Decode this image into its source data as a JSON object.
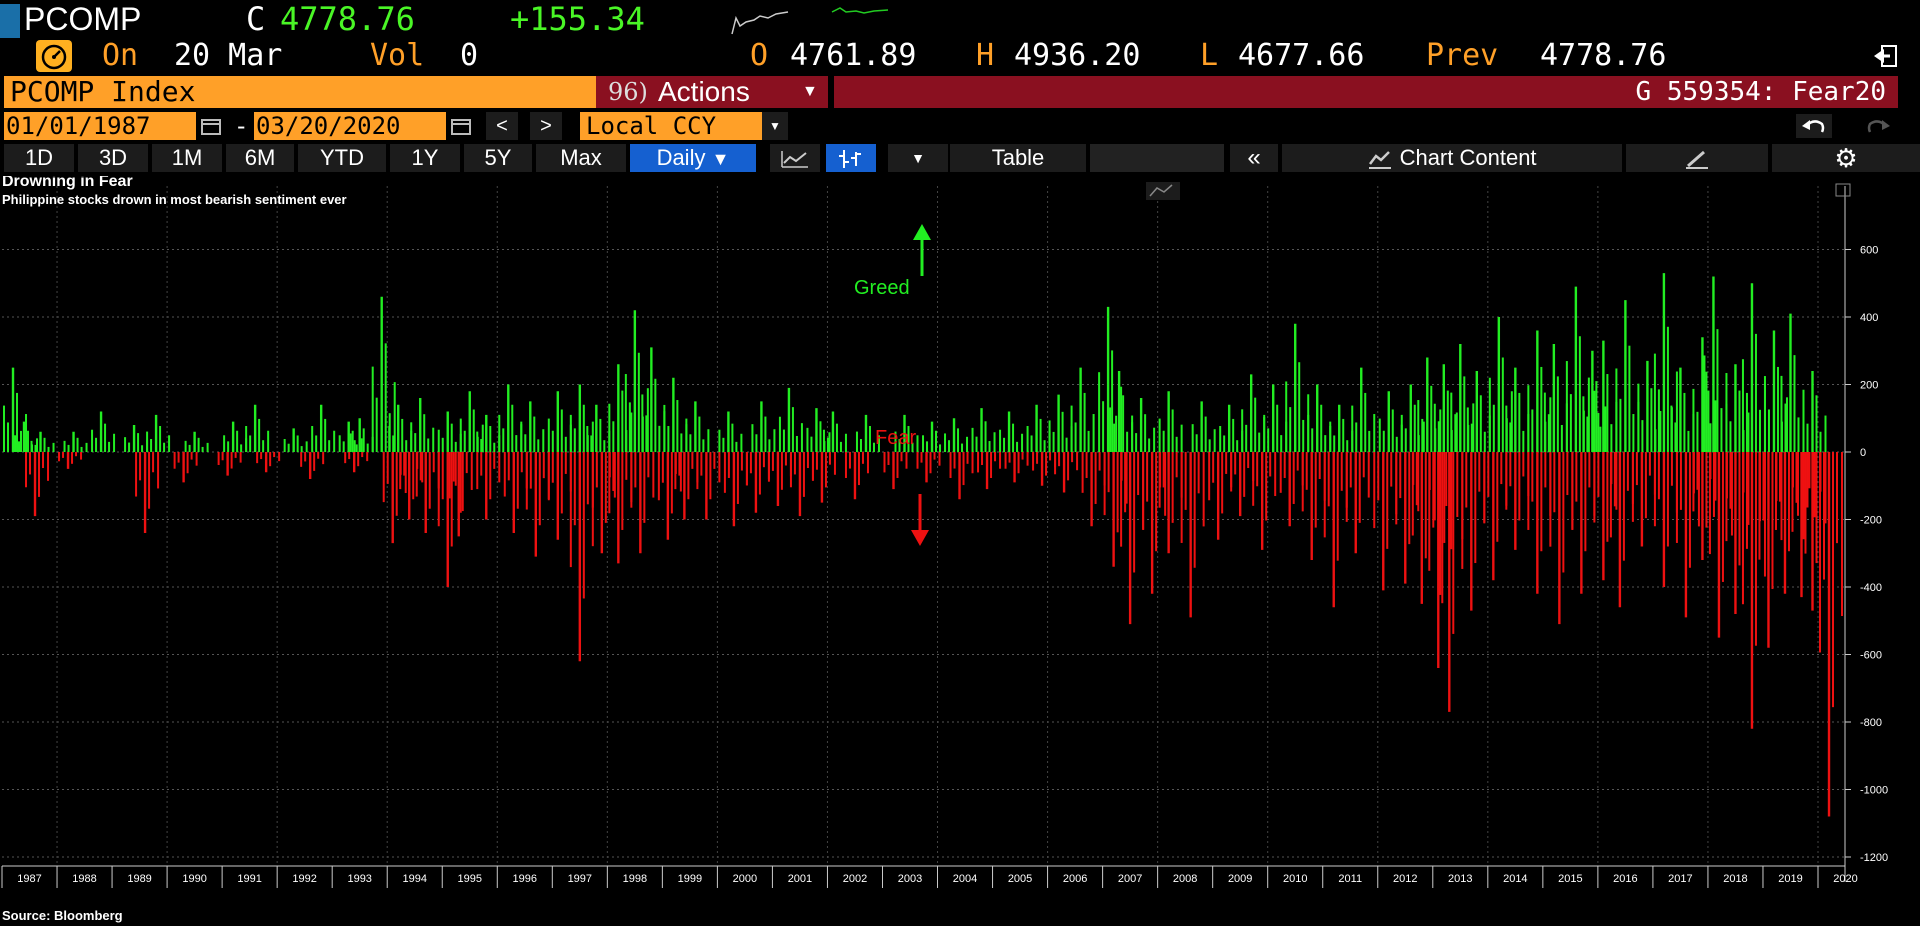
{
  "header": {
    "ticker": "PCOMP",
    "close_label": "C",
    "close_value": "4778.76",
    "change": "+155.34",
    "on_label": "On",
    "date": "20 Mar",
    "vol_label": "Vol",
    "vol_value": "0",
    "open_label": "O",
    "open_value": "4761.89",
    "high_label": "H",
    "high_value": "4936.20",
    "low_label": "L",
    "low_value": "4677.66",
    "prev_label": "Prev",
    "prev_value": "4778.76"
  },
  "toolbar": {
    "security": "PCOMP Index",
    "actions_num": "96)",
    "actions_label": "Actions",
    "function_label": "G 559354: Fear20",
    "start_date": "01/01/1987",
    "dash": "-",
    "end_date": "03/20/2020",
    "prev_glyph": "<",
    "next_glyph": ">",
    "currency": "Local CCY",
    "ranges": [
      "1D",
      "3D",
      "1M",
      "6M",
      "YTD",
      "1Y",
      "5Y",
      "Max"
    ],
    "frequency": "Daily",
    "table_label": "Table",
    "chart_content_label": "Chart Content"
  },
  "colors": {
    "positive": "#22ee22",
    "negative": "#ee1111",
    "orange": "#ffa028",
    "band_red": "#8a1020",
    "active_blue": "#1560d0"
  },
  "chart_data": {
    "type": "bar",
    "title": "Drowning in Fear",
    "subtitle": "Philippine stocks drown in most bearish sentiment ever",
    "source": "Source: Bloomberg",
    "annotations": {
      "greed": "Greed",
      "fear": "Fear"
    },
    "x_years": [
      "1987",
      "1988",
      "1989",
      "1990",
      "1991",
      "1992",
      "1993",
      "1994",
      "1995",
      "1996",
      "1997",
      "1998",
      "1999",
      "2000",
      "2001",
      "2002",
      "2003",
      "2004",
      "2005",
      "2006",
      "2007",
      "2008",
      "2009",
      "2010",
      "2011",
      "2012",
      "2013",
      "2014",
      "2015",
      "2016",
      "2017",
      "2018",
      "2019",
      "2020"
    ],
    "y_ticks": [
      "600",
      "400",
      "200",
      "0",
      "-200",
      "-400",
      "-600",
      "-800",
      "-1000",
      "-1200"
    ],
    "ylim": [
      -1200,
      650
    ],
    "legend": "none",
    "grid": true,
    "series": [
      {
        "color": "positive",
        "x": [
          1987.2,
          1987.4,
          1987.7,
          1988.3,
          1988.8,
          1989.4,
          1989.8,
          1990.5,
          1991.2,
          1991.6,
          1992.3,
          1992.8,
          1993.3,
          1993.5,
          1993.9,
          1994.2,
          1994.6,
          1995.1,
          1995.5,
          1995.8,
          1996.2,
          1996.6,
          1997.1,
          1997.5,
          1997.8,
          1998.2,
          1998.5,
          1998.8,
          1999.2,
          1999.6,
          2000.2,
          2000.8,
          2001.3,
          2001.8,
          2002.1,
          2002.7,
          2003.4,
          2003.9,
          2004.3,
          2004.8,
          2005.3,
          2005.8,
          2006.2,
          2006.6,
          2007.1,
          2007.3,
          2007.7,
          2008.2,
          2008.8,
          2009.3,
          2009.7,
          2010.1,
          2010.5,
          2010.9,
          2011.3,
          2011.7,
          2012.2,
          2012.6,
          2012.9,
          2013.2,
          2013.5,
          2013.8,
          2014.2,
          2014.5,
          2014.9,
          2015.2,
          2015.6,
          2015.9,
          2016.1,
          2016.5,
          2016.9,
          2017.2,
          2017.5,
          2017.9,
          2018.1,
          2018.5,
          2018.8,
          2019.2,
          2019.5,
          2019.9
        ],
        "y": [
          250,
          90,
          60,
          60,
          120,
          80,
          110,
          60,
          90,
          140,
          70,
          140,
          90,
          100,
          460,
          140,
          160,
          120,
          180,
          110,
          200,
          150,
          180,
          200,
          140,
          260,
          420,
          310,
          220,
          150,
          120,
          150,
          190,
          130,
          120,
          110,
          110,
          90,
          100,
          130,
          120,
          140,
          170,
          250,
          430,
          240,
          160,
          180,
          150,
          140,
          230,
          200,
          380,
          200,
          140,
          250,
          180,
          200,
          280,
          260,
          320,
          240,
          400,
          250,
          360,
          320,
          490,
          300,
          330,
          450,
          270,
          530,
          250,
          340,
          520,
          260,
          500,
          360,
          410,
          240
        ]
      },
      {
        "color": "negative",
        "x": [
          1987.6,
          1988.2,
          1989.6,
          1990.3,
          1991.1,
          1991.8,
          1992.6,
          1993.4,
          1994.1,
          1994.4,
          1994.7,
          1995.1,
          1995.3,
          1995.8,
          1996.3,
          1996.7,
          1997.1,
          1997.5,
          1997.9,
          1998.2,
          1998.6,
          1999.1,
          1999.4,
          1999.8,
          2000.3,
          2000.7,
          2001.1,
          2001.5,
          2001.9,
          2002.5,
          2003.2,
          2003.8,
          2004.4,
          2004.9,
          2005.4,
          2005.9,
          2006.3,
          2006.8,
          2007.2,
          2007.5,
          2007.9,
          2008.2,
          2008.6,
          2009.1,
          2009.5,
          2009.9,
          2010.4,
          2010.8,
          2011.2,
          2011.6,
          2012.1,
          2012.5,
          2012.8,
          2013.1,
          2013.3,
          2013.7,
          2014.1,
          2014.5,
          2014.9,
          2015.3,
          2015.7,
          2016.1,
          2016.4,
          2016.8,
          2017.2,
          2017.6,
          2017.9,
          2018.2,
          2018.5,
          2018.8,
          2019.1,
          2019.4,
          2019.7,
          2019.9,
          2020.2
        ],
        "y": [
          -190,
          -50,
          -240,
          -90,
          -70,
          -60,
          -80,
          -60,
          -270,
          -200,
          -240,
          -400,
          -250,
          -200,
          -240,
          -310,
          -260,
          -620,
          -300,
          -330,
          -300,
          -260,
          -200,
          -200,
          -220,
          -180,
          -160,
          -190,
          -150,
          -140,
          -110,
          -90,
          -140,
          -110,
          -90,
          -100,
          -120,
          -220,
          -340,
          -510,
          -420,
          -300,
          -490,
          -260,
          -190,
          -290,
          -220,
          -320,
          -460,
          -300,
          -410,
          -390,
          -450,
          -640,
          -770,
          -470,
          -380,
          -290,
          -420,
          -510,
          -420,
          -380,
          -460,
          -280,
          -400,
          -490,
          -320,
          -550,
          -480,
          -820,
          -580,
          -420,
          -430,
          -470,
          -1080
        ]
      }
    ]
  }
}
